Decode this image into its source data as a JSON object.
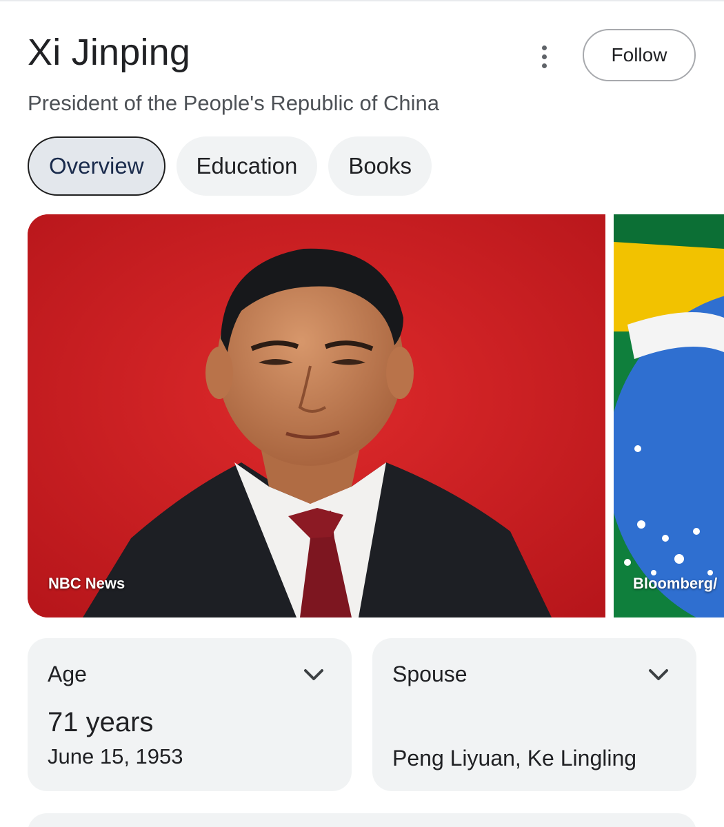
{
  "header": {
    "title": "Xi Jinping",
    "subtitle": "President of the People's Republic of China",
    "follow_label": "Follow",
    "more_icon": "more-vert-icon"
  },
  "tabs": [
    {
      "label": "Overview",
      "active": true
    },
    {
      "label": "Education",
      "active": false
    },
    {
      "label": "Books",
      "active": false
    }
  ],
  "images": [
    {
      "credit": "NBC News"
    },
    {
      "credit": "Bloomberg/"
    }
  ],
  "facts": {
    "age": {
      "label": "Age",
      "value": "71 years",
      "detail": "June 15, 1953",
      "icon": "chevron-down-icon"
    },
    "spouse": {
      "label": "Spouse",
      "value": "Peng Liyuan, Ke Lingling",
      "icon": "chevron-down-icon"
    }
  },
  "colors": {
    "accent_text": "#1a2b4c",
    "chip_bg": "#f1f3f4",
    "photo_background": "#d01a1f"
  }
}
